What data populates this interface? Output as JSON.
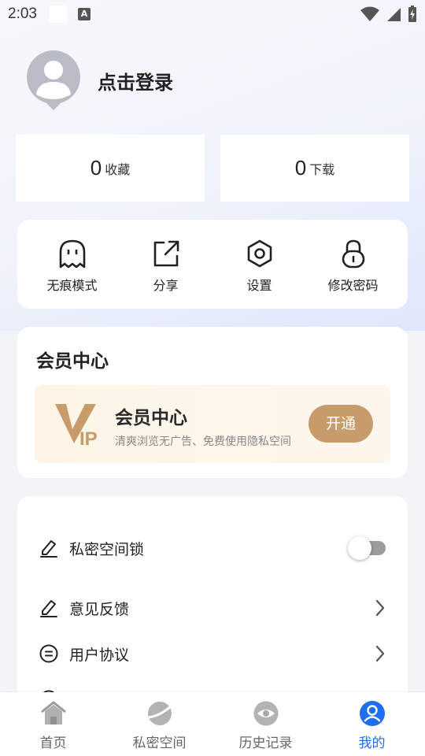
{
  "status_bar": {
    "time": "2:03",
    "a_icon": "A"
  },
  "profile": {
    "login_text": "点击登录"
  },
  "stats": [
    {
      "count": "0",
      "label": "收藏"
    },
    {
      "count": "0",
      "label": "下载"
    }
  ],
  "quick_actions": [
    {
      "label": "无痕模式",
      "icon": "ghost-icon"
    },
    {
      "label": "分享",
      "icon": "share-icon"
    },
    {
      "label": "设置",
      "icon": "settings-icon"
    },
    {
      "label": "修改密码",
      "icon": "lock-icon"
    }
  ],
  "vip": {
    "section_title": "会员中心",
    "banner_title": "会员中心",
    "banner_subtitle": "清爽浏览无广告、免费使用隐私空间",
    "open_button": "开通",
    "logo_text": "VIP"
  },
  "settings": [
    {
      "label": "私密空间锁",
      "control": "toggle",
      "enabled": false
    },
    {
      "label": "意见反馈",
      "control": "chevron"
    },
    {
      "label": "用户协议",
      "control": "chevron"
    }
  ],
  "bottom_nav": [
    {
      "label": "首页",
      "icon": "home-icon",
      "active": false
    },
    {
      "label": "私密空间",
      "icon": "planet-icon",
      "active": false
    },
    {
      "label": "历史记录",
      "icon": "eye-icon",
      "active": false
    },
    {
      "label": "我的",
      "icon": "user-icon",
      "active": true
    }
  ],
  "colors": {
    "accent": "#1e6ff0",
    "vip_gold": "#c89c6a",
    "vip_bg": "#fdf4e4"
  }
}
